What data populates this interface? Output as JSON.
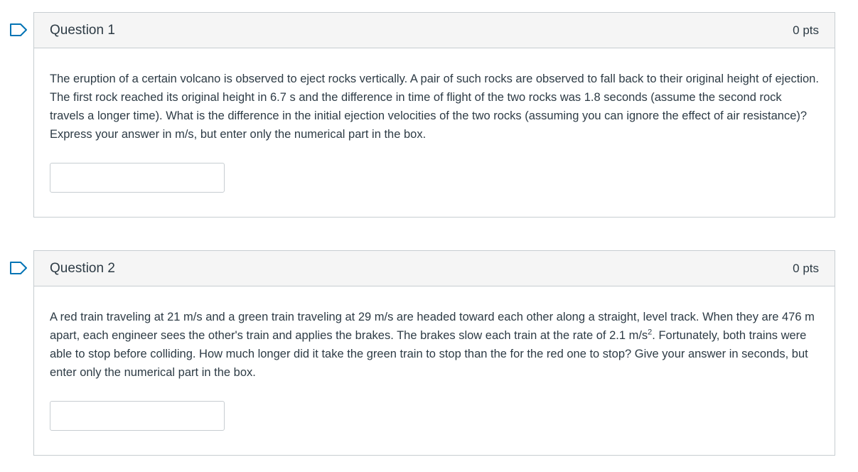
{
  "questions": [
    {
      "title": "Question 1",
      "points": "0 pts",
      "text": "The eruption of a certain volcano is observed to eject rocks vertically. A pair of such rocks are observed to fall back to their original height of ejection.  The first rock reached its original height in 6.7 s and the difference in time of flight of the two rocks was 1.8 seconds (assume the second rock travels a longer time).  What is the difference in the initial ejection velocities of the two rocks (assuming you can ignore the effect of air resistance)?  Express your answer in m/s, but enter only the numerical part in the box.",
      "answer_value": ""
    },
    {
      "title": "Question 2",
      "points": "0 pts",
      "text_before_sup": "A red train traveling at 21 m/s and a green train traveling at 29 m/s are headed toward each other along a straight, level track. When they are 476 m apart, each engineer sees the other's train and applies the brakes. The brakes slow each train at the rate of 2.1 m/s",
      "sup": "2",
      "text_after_sup": ". Fortunately, both trains were able to stop before colliding.  How much longer did it take the green train to stop than the for the red one to stop? Give your answer in seconds, but enter only the numerical part in the box.",
      "answer_value": ""
    }
  ],
  "icons": {
    "flag": "bookmark-flag-icon",
    "flag_color": "#0374b5"
  }
}
